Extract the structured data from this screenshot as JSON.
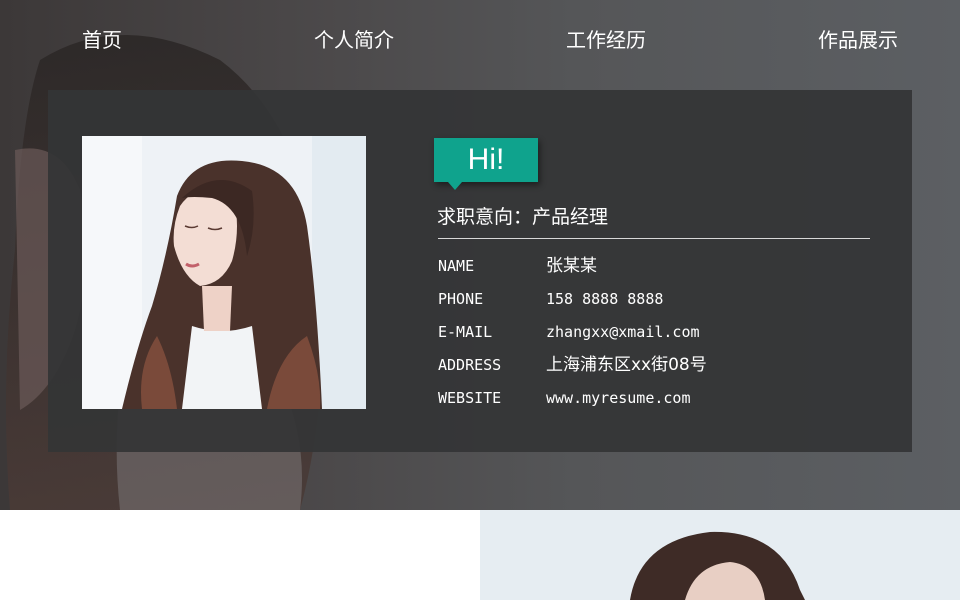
{
  "nav": {
    "items": [
      "首页",
      "个人简介",
      "工作经历",
      "作品展示"
    ]
  },
  "card": {
    "greeting": "Hi!",
    "objective": "求职意向：产品经理",
    "info": [
      {
        "label": "NAME",
        "value": "张某某"
      },
      {
        "label": "PHONE",
        "value": "158 8888 8888"
      },
      {
        "label": "E-MAIL",
        "value": "zhangxx@xmail.com"
      },
      {
        "label": "ADDRESS",
        "value": "上海浦东区xx街08号"
      },
      {
        "label": "WEBSITE",
        "value": "www.myresume.com"
      }
    ]
  },
  "colors": {
    "accent": "#0fa38d",
    "card_bg": "#343536",
    "text": "#ffffff"
  }
}
